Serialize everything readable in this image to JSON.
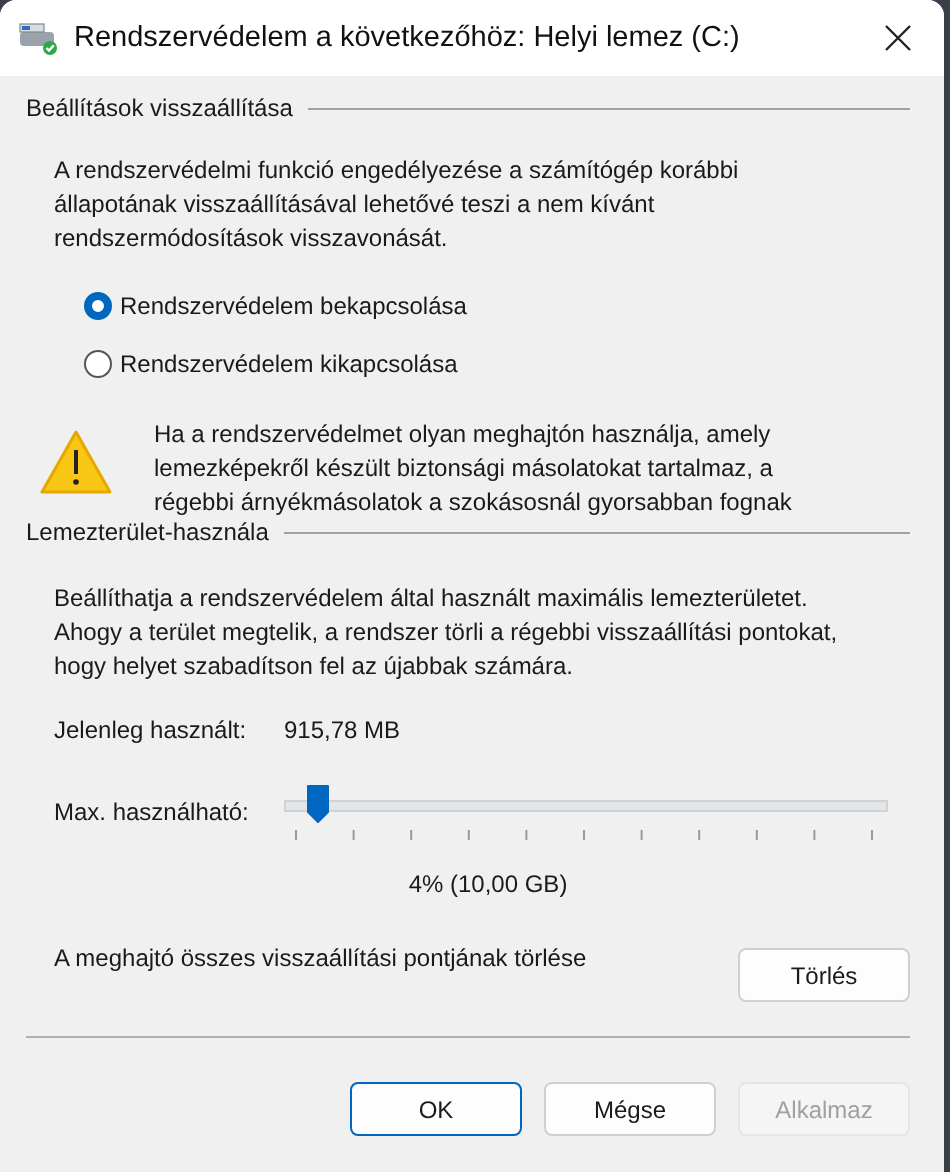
{
  "window": {
    "title": "Rendszervédelem a következőhöz: Helyi lemez (C:)"
  },
  "restore_settings": {
    "heading": "Beállítások visszaállítása",
    "description": "A rendszervédelmi funkció engedélyezése a számítógép korábbi\nállapotának visszaállításával lehetővé teszi a nem kívánt\nrendszermódosítások visszavonását.",
    "options": [
      {
        "label": "Rendszervédelem bekapcsolása",
        "selected": true
      },
      {
        "label": "Rendszervédelem kikapcsolása",
        "selected": false
      }
    ],
    "warning": "Ha a rendszervédelmet olyan meghajtón használja, amely\nlemezképekről készült biztonsági másolatokat tartalmaz, a\nrégebbi árnyékmásolatok a szokásosnál gyorsabban fognak"
  },
  "disk_usage": {
    "heading": "Lemezterület-használa",
    "description": "Beállíthatja a rendszervédelem által használt maximális lemezterületet.\nAhogy a terület megtelik, a rendszer törli a régebbi visszaállítási pontokat,\nhogy helyet szabadítson fel az újabbak számára.",
    "current_label": "Jelenleg használt:",
    "current_value": "915,78 MB",
    "max_label": "Max. használható:",
    "max_slider": {
      "level": 0.03
    },
    "max_reading": "4% (10,00 GB)",
    "delete_label": "A meghajtó összes visszaállítási pontjának törlése",
    "delete_button": "Törlés"
  },
  "buttons": [
    {
      "label": "OK",
      "disabled": false,
      "default": true
    },
    {
      "label": "Mégse",
      "disabled": false,
      "default": false
    },
    {
      "label": "Alkalmaz",
      "disabled": true,
      "default": false
    }
  ]
}
